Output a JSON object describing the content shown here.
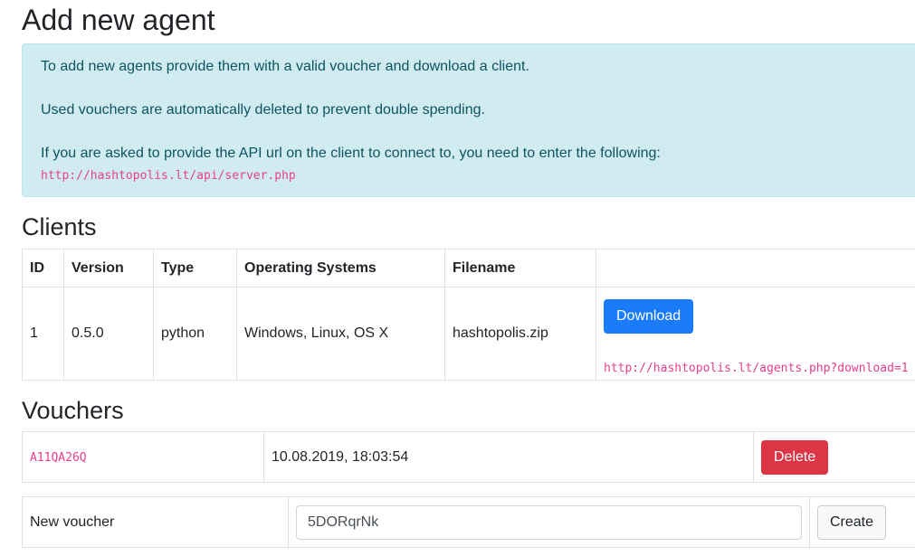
{
  "page": {
    "title": "Add new agent"
  },
  "info": {
    "line1": "To add new agents provide them with a valid voucher and download a client.",
    "line2": "Used vouchers are automatically deleted to prevent double spending.",
    "line3": "If you are asked to provide the API url on the client to connect to, you need to enter the following:",
    "api_url": "http://hashtopolis.lt/api/server.php"
  },
  "clients": {
    "heading": "Clients",
    "columns": [
      "ID",
      "Version",
      "Type",
      "Operating Systems",
      "Filename",
      ""
    ],
    "rows": [
      {
        "id": "1",
        "version": "0.5.0",
        "type": "python",
        "os": "Windows, Linux, OS X",
        "filename": "hashtopolis.zip",
        "download_label": "Download",
        "download_url": "http://hashtopolis.lt/agents.php?download=1"
      }
    ]
  },
  "vouchers": {
    "heading": "Vouchers",
    "rows": [
      {
        "code": "A11QA26Q",
        "created": "10.08.2019, 18:03:54",
        "delete_label": "Delete"
      }
    ]
  },
  "new_voucher": {
    "label": "New voucher",
    "value": "5DORqrNk",
    "create_label": "Create"
  },
  "colors": {
    "primary": "#1a7cfb",
    "danger": "#dc3545",
    "info_bg": "#d1ecf1",
    "code": "#e83e8c"
  }
}
